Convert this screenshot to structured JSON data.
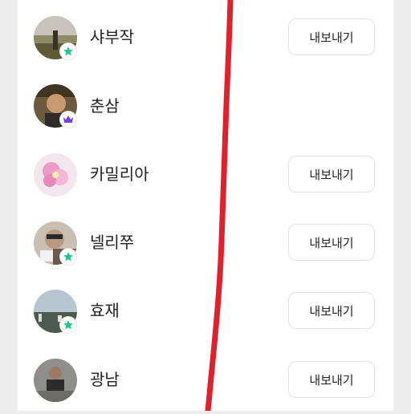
{
  "members": [
    {
      "name": "샤부작",
      "badge": "star",
      "action": "내보내기"
    },
    {
      "name": "춘삼",
      "badge": "crown",
      "action": ""
    },
    {
      "name": "카밀리아",
      "badge": "",
      "action": "내보내기"
    },
    {
      "name": "넬리쭈",
      "badge": "star",
      "action": "내보내기"
    },
    {
      "name": "효재",
      "badge": "star",
      "action": "내보내기"
    },
    {
      "name": "광남",
      "badge": "",
      "action": "내보내기"
    }
  ],
  "colors": {
    "star_badge": "#1fc88a",
    "crown_badge": "#7b3fe4",
    "scribble": "#e0202a"
  }
}
